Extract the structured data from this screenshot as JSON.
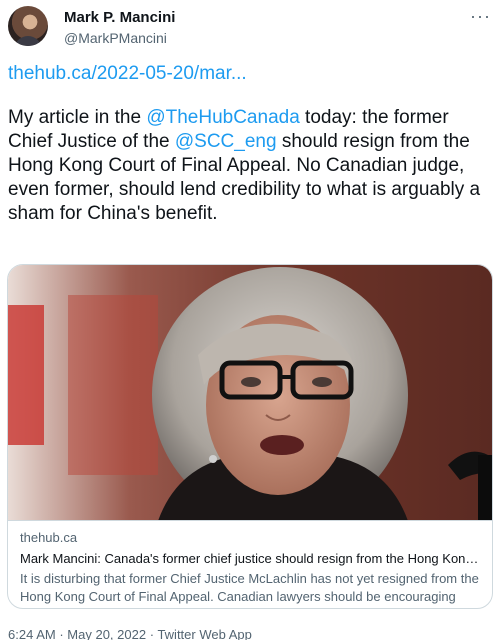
{
  "user": {
    "display_name": "Mark P. Mancini",
    "handle": "@MarkPMancini",
    "avatar_icon": "profile-photo"
  },
  "more_icon": "more-horizontal-icon",
  "tweet": {
    "link_text": "thehub.ca/2022-05-20/mar...",
    "text_1": "My article in the ",
    "mention_1": "@TheHubCanada",
    "text_2": " today: the former Chief Justice of the ",
    "mention_2": "@SCC_eng",
    "text_3": " should resign from the Hong Kong Court of Final Appeal. No Canadian judge, even former, should lend credibility to what is arguably a sham for China's benefit."
  },
  "card": {
    "domain": "thehub.ca",
    "title": "Mark Mancini: Canada's former chief justice should resign from the Hong Kong ...",
    "description": "It is disturbing that former Chief Justice McLachlin has not yet resigned from the Hong Kong Court of Final Appeal. Canadian lawyers should be encouraging Chi..."
  },
  "meta": {
    "time": "6:24 AM",
    "date": "May 20, 2022",
    "source": "Twitter Web App",
    "separator": "·"
  },
  "colors": {
    "link": "#1d9bf0",
    "text": "#0f1419",
    "muted": "#536471",
    "border": "#cfd9de"
  }
}
